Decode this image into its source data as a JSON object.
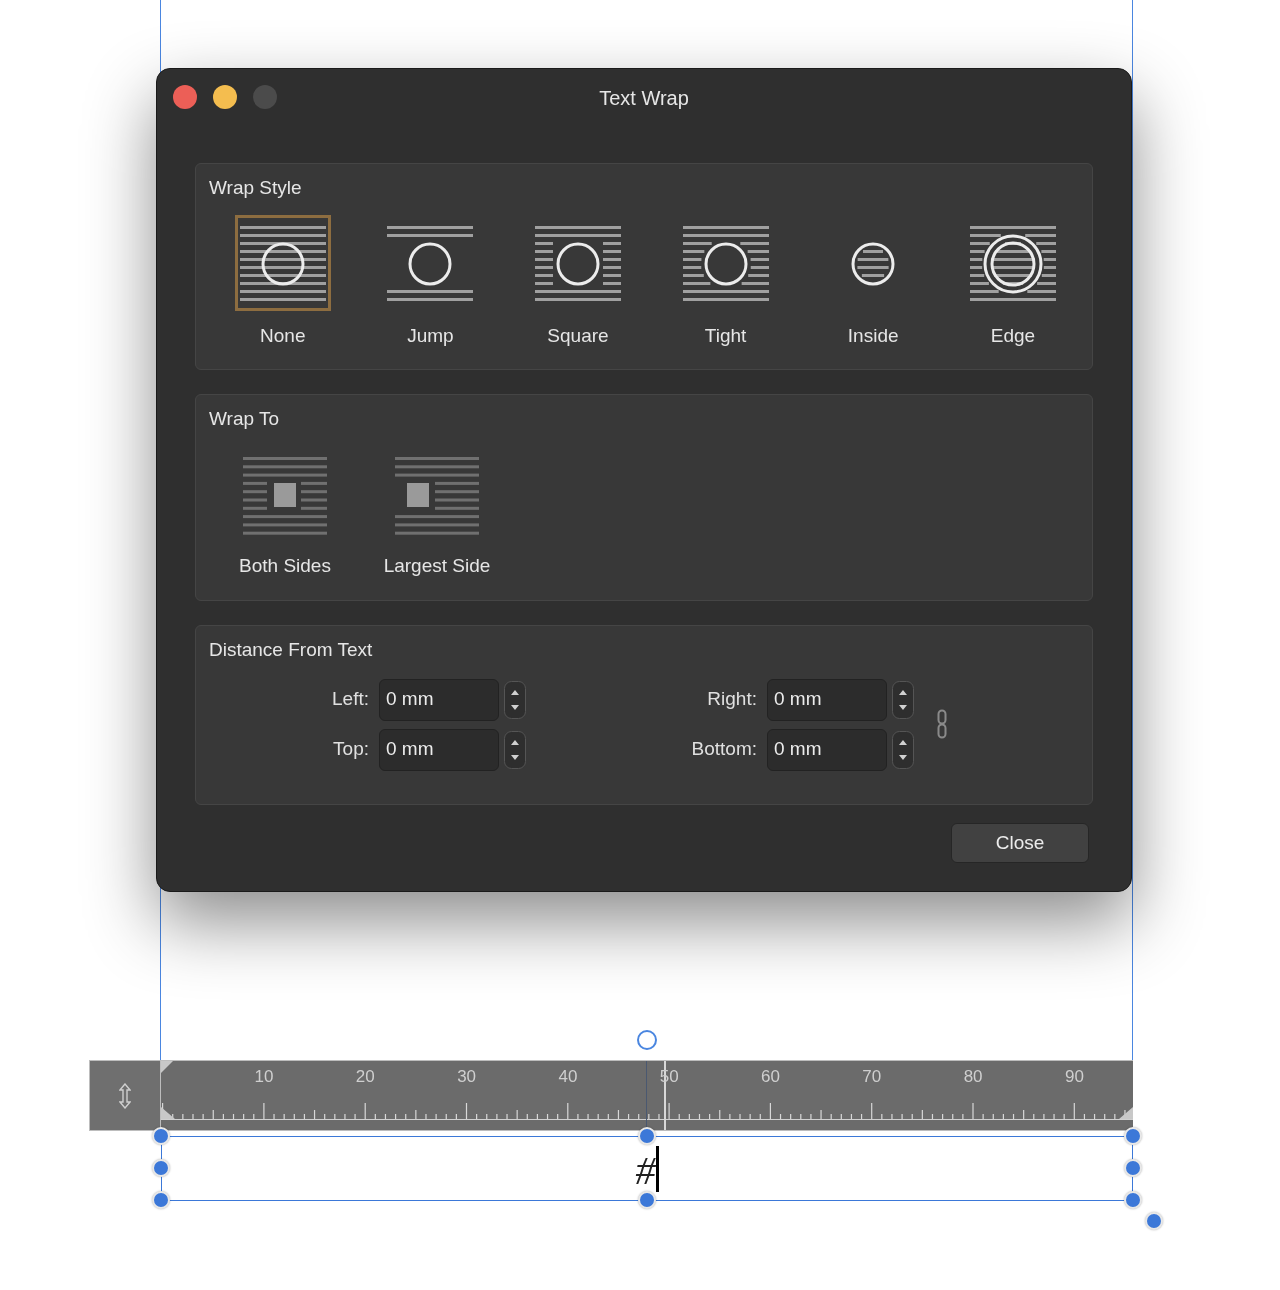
{
  "window": {
    "title": "Text Wrap"
  },
  "wrap_style": {
    "title": "Wrap Style",
    "options": [
      {
        "label": "None",
        "kind": "none",
        "selected": true
      },
      {
        "label": "Jump",
        "kind": "jump",
        "selected": false
      },
      {
        "label": "Square",
        "kind": "square",
        "selected": false
      },
      {
        "label": "Tight",
        "kind": "tight",
        "selected": false
      },
      {
        "label": "Inside",
        "kind": "inside",
        "selected": false
      },
      {
        "label": "Edge",
        "kind": "edge",
        "selected": false
      }
    ]
  },
  "wrap_to": {
    "title": "Wrap To",
    "options": [
      {
        "label": "Both Sides",
        "kind": "both",
        "selected": false
      },
      {
        "label": "Largest Side",
        "kind": "largest",
        "selected": false
      }
    ]
  },
  "distance": {
    "title": "Distance From Text",
    "fields": [
      {
        "label": "Left:",
        "value": "0 mm"
      },
      {
        "label": "Right:",
        "value": "0 mm"
      },
      {
        "label": "Top:",
        "value": "0 mm"
      },
      {
        "label": "Bottom:",
        "value": "0 mm"
      }
    ]
  },
  "buttons": [
    "Close"
  ],
  "ruler": {
    "labels": [
      "10",
      "20",
      "30",
      "40",
      "50",
      "60",
      "70",
      "80",
      "90"
    ]
  },
  "text_frame": {
    "text": "#"
  }
}
